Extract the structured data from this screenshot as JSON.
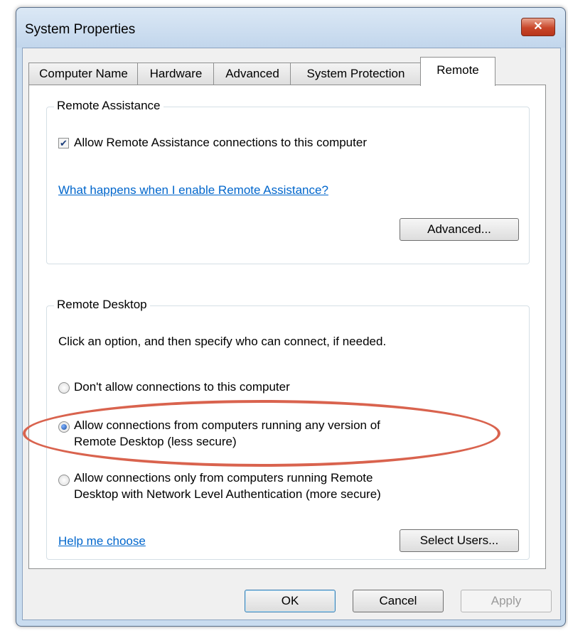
{
  "window": {
    "title": "System Properties",
    "close_glyph": "✕"
  },
  "tabs": [
    {
      "label": "Computer Name",
      "active": false
    },
    {
      "label": "Hardware",
      "active": false
    },
    {
      "label": "Advanced",
      "active": false
    },
    {
      "label": "System Protection",
      "active": false
    },
    {
      "label": "Remote",
      "active": true
    }
  ],
  "remote_assistance": {
    "group_label": "Remote Assistance",
    "checkbox_label": "Allow Remote Assistance connections to this computer",
    "checkbox_checked": true,
    "help_link": "What happens when I enable Remote Assistance?",
    "advanced_button": "Advanced..."
  },
  "remote_desktop": {
    "group_label": "Remote Desktop",
    "instructions": "Click an option, and then specify who can connect, if needed.",
    "options": [
      {
        "line1": "Don't allow connections to this computer",
        "line2": "",
        "selected": false
      },
      {
        "line1": "Allow connections from computers running any version of",
        "line2": "Remote Desktop (less secure)",
        "selected": true
      },
      {
        "line1": "Allow connections only from computers running Remote",
        "line2": "Desktop with Network Level Authentication (more secure)",
        "selected": false
      }
    ],
    "help_link": "Help me choose",
    "select_users_button": "Select Users..."
  },
  "footer": {
    "ok": "OK",
    "cancel": "Cancel",
    "apply": "Apply"
  },
  "colors": {
    "highlight_ellipse": "#d9634e",
    "link": "#0066cc"
  }
}
